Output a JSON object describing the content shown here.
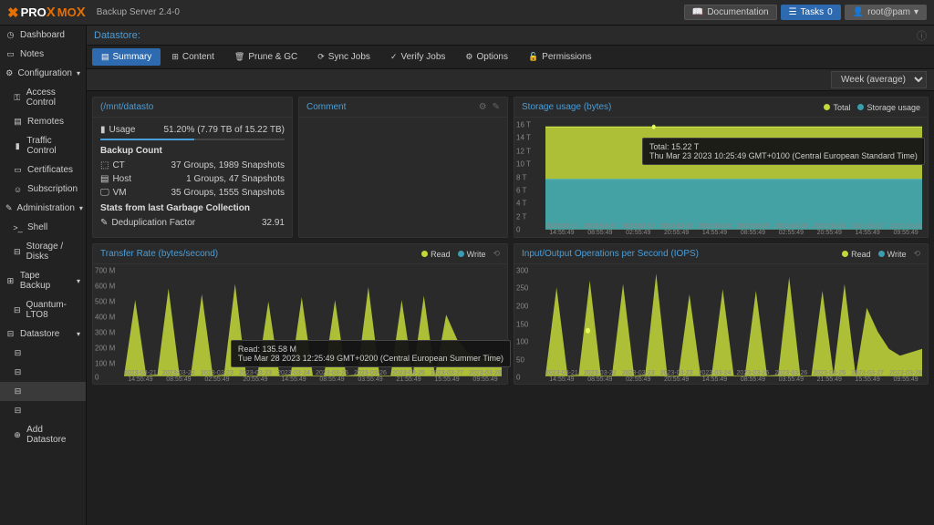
{
  "app": {
    "name1": "PRO",
    "name2": "MO",
    "version": "Backup Server 2.4-0"
  },
  "topbtns": {
    "docs": "Documentation",
    "tasks": "Tasks",
    "taskcount": "0",
    "user": "root@pam"
  },
  "sidebar": {
    "dashboard": "Dashboard",
    "notes": "Notes",
    "configuration": "Configuration",
    "access": "Access Control",
    "remotes": "Remotes",
    "traffic": "Traffic Control",
    "certs": "Certificates",
    "subscription": "Subscription",
    "administration": "Administration",
    "shell": "Shell",
    "disks": "Storage / Disks",
    "tape": "Tape Backup",
    "quantum": "Quantum-LTO8",
    "datastore": "Datastore",
    "add_ds": "Add Datastore"
  },
  "header": {
    "title": "Datastore:"
  },
  "tabs": {
    "summary": "Summary",
    "content": "Content",
    "prune": "Prune & GC",
    "sync": "Sync Jobs",
    "verify": "Verify Jobs",
    "options": "Options",
    "permissions": "Permissions"
  },
  "toolbar": {
    "range": "Week (average)"
  },
  "summary_panel": {
    "title": "(/mnt/datasto",
    "usage_label": "Usage",
    "usage_val": "51.20% (7.79 TB of 15.22 TB)",
    "backup_count": "Backup Count",
    "ct": "CT",
    "ct_val": "37 Groups, 1989 Snapshots",
    "host": "Host",
    "host_val": "1 Groups, 47 Snapshots",
    "vm": "VM",
    "vm_val": "35 Groups, 1555 Snapshots",
    "gc_title": "Stats from last Garbage Collection",
    "dedup": "Deduplication Factor",
    "dedup_val": "32.91"
  },
  "comment_panel": {
    "title": "Comment"
  },
  "storage_panel": {
    "title": "Storage usage (bytes)",
    "legend": {
      "total": "Total",
      "usage": "Storage usage"
    },
    "tooltip": {
      "l1": "Total: 15.22 T",
      "l2": "Thu Mar 23 2023 10:25:49 GMT+0100 (Central European Standard Time)"
    }
  },
  "transfer_panel": {
    "title": "Transfer Rate (bytes/second)",
    "legend": {
      "read": "Read",
      "write": "Write"
    },
    "tooltip": {
      "l1": "Read: 135.58 M",
      "l2": "Tue Mar 28 2023 12:25:49 GMT+0200 (Central European Summer Time)"
    }
  },
  "iops_panel": {
    "title": "Input/Output Operations per Second (IOPS)",
    "legend": {
      "read": "Read",
      "write": "Write"
    }
  },
  "chart_data": {
    "storage_usage": {
      "type": "area",
      "ylabel": "bytes",
      "y_ticks": [
        "16 T",
        "14 T",
        "12 T",
        "10 T",
        "8 T",
        "6 T",
        "4 T",
        "2 T",
        "0"
      ],
      "ylim": [
        0,
        16000000000000
      ],
      "x_categories": [
        "2023-03-21 14:55:49",
        "2023-03-22 08:55:49",
        "2023-03-22 02:55:49",
        "2023-03-23 20:55:49",
        "2023-03-24 14:55:49",
        "2023-03-25 08:55:49",
        "2023-03-26 02:55:49",
        "2023-03-26 20:55:49",
        "2023-03-27 14:55:49",
        "2023-03-28 09:55:49"
      ],
      "series": [
        {
          "name": "Total",
          "color": "#c4d83a",
          "values": [
            15.22,
            15.22,
            15.22,
            15.22,
            15.22,
            15.22,
            15.22,
            15.22,
            15.22,
            15.22
          ],
          "unit": "T"
        },
        {
          "name": "Storage usage",
          "color": "#3a9eb0",
          "values": [
            7.7,
            7.7,
            7.7,
            7.7,
            7.75,
            7.78,
            7.78,
            7.79,
            7.79,
            7.79
          ],
          "unit": "T"
        }
      ]
    },
    "transfer_rate": {
      "type": "area",
      "ylabel": "bytes/second",
      "y_ticks": [
        "700 M",
        "600 M",
        "500 M",
        "400 M",
        "300 M",
        "200 M",
        "100 M",
        "0"
      ],
      "ylim": [
        0,
        700000000
      ],
      "x_categories": [
        "2023-03-21 14:55:49",
        "2023-03-22 08:55:49",
        "2023-03-23 02:55:49",
        "2023-03-23 20:55:49",
        "2023-03-24 14:55:49",
        "2023-03-25 08:55:49",
        "2023-03-26 03:55:49",
        "2023-03-26 21:55:49",
        "2023-03-27 15:55:49",
        "2023-03-28 09:55:49"
      ],
      "series": [
        {
          "name": "Read",
          "color": "#c4d83a",
          "values": [
            5,
            520,
            5,
            10,
            600,
            5,
            5,
            560,
            5,
            10,
            630,
            5,
            5,
            510,
            5,
            10,
            540,
            5,
            5,
            520,
            5,
            10,
            610,
            5,
            5,
            520,
            10,
            550,
            5,
            420,
            250,
            160,
            120,
            130,
            140
          ],
          "unit": "M"
        },
        {
          "name": "Write",
          "color": "#3a9eb0",
          "values": [
            2,
            2,
            2,
            2,
            2,
            2,
            2,
            2,
            2,
            2,
            2,
            2,
            2,
            2,
            2,
            2,
            2,
            2,
            2,
            2,
            2,
            2,
            2,
            2,
            2,
            2,
            2,
            2,
            2,
            2,
            2,
            2,
            2,
            2,
            2
          ],
          "unit": "M"
        }
      ]
    },
    "iops": {
      "type": "area",
      "ylabel": "IOPS",
      "y_ticks": [
        "300",
        "250",
        "200",
        "150",
        "100",
        "50",
        "0"
      ],
      "ylim": [
        0,
        300
      ],
      "x_categories": [
        "2023-03-21 14:55:49",
        "2023-03-22 08:55:49",
        "2023-03-23 02:55:49",
        "2023-03-23 20:55:49",
        "2023-03-24 14:55:49",
        "2023-03-25 08:55:49",
        "2023-03-26 03:55:49",
        "2023-03-26 21:55:49",
        "2023-03-27 15:55:49",
        "2023-03-28 09:55:49"
      ],
      "series": [
        {
          "name": "Read",
          "color": "#c4d83a",
          "values": [
            2,
            260,
            2,
            4,
            280,
            2,
            2,
            270,
            2,
            4,
            300,
            2,
            2,
            240,
            2,
            4,
            255,
            2,
            2,
            250,
            2,
            4,
            290,
            2,
            2,
            250,
            4,
            270,
            2,
            200,
            130,
            80,
            60,
            70,
            80
          ],
          "unit": ""
        },
        {
          "name": "Write",
          "color": "#3a9eb0",
          "values": [
            1,
            1,
            1,
            1,
            1,
            1,
            1,
            1,
            1,
            1,
            1,
            1,
            1,
            1,
            1,
            1,
            1,
            1,
            1,
            1,
            1,
            1,
            1,
            1,
            1,
            1,
            1,
            1,
            1,
            1,
            1,
            1,
            1,
            1,
            1
          ],
          "unit": ""
        }
      ]
    }
  }
}
